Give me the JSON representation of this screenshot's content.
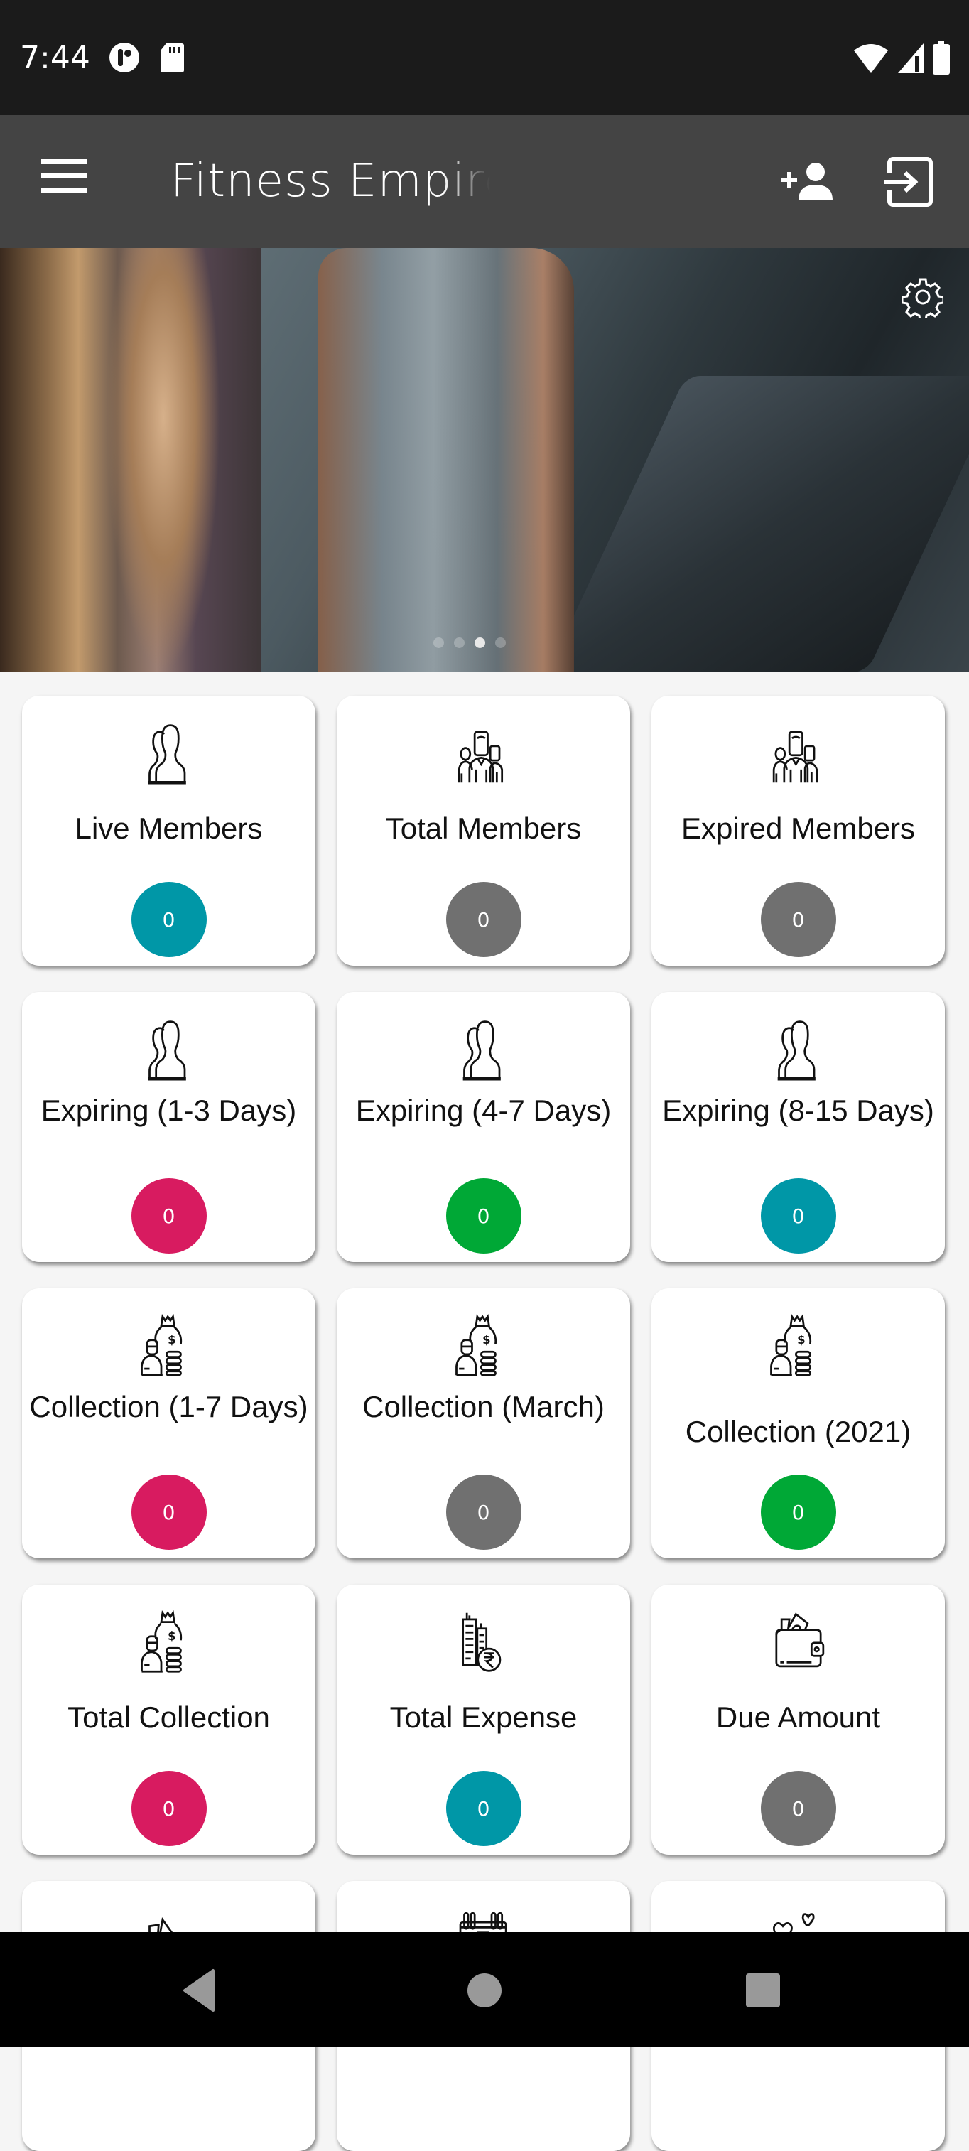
{
  "status_bar": {
    "time": "7:44",
    "left_icons": [
      "data-saver-icon",
      "sd-card-icon"
    ],
    "right_icons": [
      "wifi-icon",
      "signal-icon",
      "battery-icon"
    ]
  },
  "toolbar": {
    "title": "Fitness Empire",
    "menu_icon": "hamburger-menu-icon",
    "actions": [
      "add-member-icon",
      "logout-icon"
    ]
  },
  "banner": {
    "settings_icon": "gear-icon",
    "dots_count": 4,
    "active_dot": 3
  },
  "colors": {
    "teal": "#0097a7",
    "gray": "#707070",
    "pink": "#d81b60",
    "green": "#00a836",
    "toolbar": "#444444",
    "status_bar": "#1b1b1b"
  },
  "cards": [
    {
      "label": "Live Members",
      "value": "0",
      "icon": "two-users-icon",
      "color": "#0097a7",
      "lines": 1
    },
    {
      "label": "Total Members",
      "value": "0",
      "icon": "group-icon",
      "color": "#707070",
      "lines": 1
    },
    {
      "label": "Expired Members",
      "value": "0",
      "icon": "group-icon",
      "color": "#707070",
      "lines": 1
    },
    {
      "label": "Expiring (1-3 Days)",
      "value": "0",
      "icon": "two-users-icon",
      "color": "#d81b60",
      "lines": 2
    },
    {
      "label": "Expiring (4-7 Days)",
      "value": "0",
      "icon": "two-users-icon",
      "color": "#00a836",
      "lines": 2
    },
    {
      "label": "Expiring (8-15 Days)",
      "value": "0",
      "icon": "two-users-icon",
      "color": "#0097a7",
      "lines": 2
    },
    {
      "label": "Collection (1-7 Days)",
      "value": "0",
      "icon": "money-bag-icon",
      "color": "#d81b60",
      "lines": 2
    },
    {
      "label": "Collection (March)",
      "value": "0",
      "icon": "money-bag-icon",
      "color": "#707070",
      "lines": 2
    },
    {
      "label": "Collection (2021)",
      "value": "0",
      "icon": "money-bag-icon",
      "color": "#00a836",
      "lines": 1.5
    },
    {
      "label": "Total Collection",
      "value": "0",
      "icon": "money-bag-icon",
      "color": "#d81b60",
      "lines": 1
    },
    {
      "label": "Total Expense",
      "value": "0",
      "icon": "building-rupee-icon",
      "color": "#0097a7",
      "lines": 1
    },
    {
      "label": "Due Amount",
      "value": "0",
      "icon": "wallet-icon",
      "color": "#707070",
      "lines": 1
    },
    {
      "label": "",
      "value": "",
      "icon": "cash-wallet-icon",
      "color": "",
      "lines": 0
    },
    {
      "label": "",
      "value": "",
      "icon": "calendar-icon",
      "color": "",
      "lines": 0
    },
    {
      "label": "",
      "value": "",
      "icon": "hearts-gift-icon",
      "color": "",
      "lines": 0
    }
  ],
  "nav_bar": {
    "buttons": [
      "back-icon",
      "home-icon",
      "recents-icon"
    ]
  }
}
